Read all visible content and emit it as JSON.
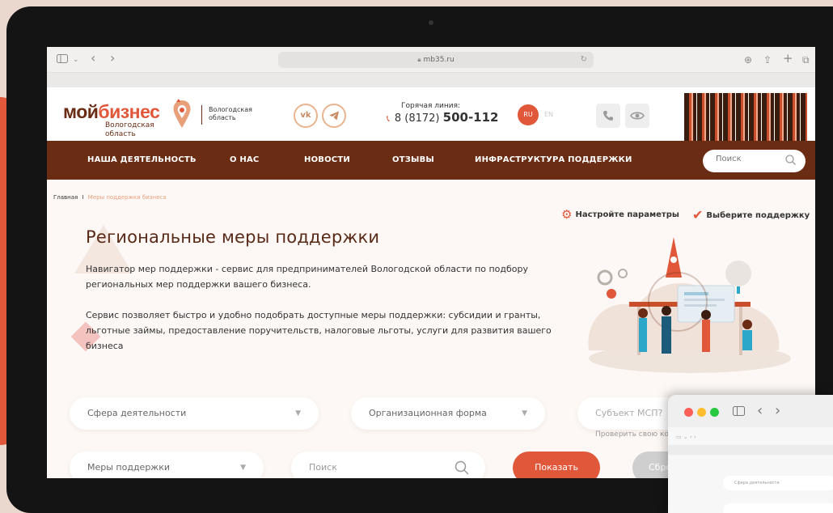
{
  "browser": {
    "url": "mb35.ru",
    "sidebar_icon": "sidebar-icon",
    "back_glyph": "‹",
    "forward_glyph": "›",
    "chevron_glyph": "⌄",
    "download_glyph": "⊕",
    "share_glyph": "⇪",
    "new_tab_glyph": "+",
    "tabs_glyph": "⧉",
    "reload_glyph": "↻"
  },
  "header": {
    "logo_part1": "мой",
    "logo_part2": "бизнес",
    "logo_sub": "Вологодская область",
    "region_line1": "Вологодская",
    "region_line2": "область",
    "vk_label": "vk",
    "hotline_label": "Горячая линия:",
    "hotline_prefix": "8 (8172)",
    "hotline_number": "500-112",
    "lang_ru": "RU",
    "lang_en": "EN"
  },
  "nav": {
    "items": [
      "НАША ДЕЯТЕЛЬНОСТЬ",
      "О НАС",
      "НОВОСТИ",
      "ОТЗЫВЫ",
      "ИНФРАСТРУКТУРА ПОДДЕРЖКИ"
    ],
    "search_placeholder": "Поиск"
  },
  "breadcrumb": {
    "home": "Главная",
    "separator": "I",
    "current": "Меры поддержки бизнеса"
  },
  "steps": {
    "params": "Настройте параметры",
    "choose": "Выберите поддержку"
  },
  "content": {
    "title": "Региональные меры поддержки",
    "para1_line1": "Навигатор мер поддержки - сервис для предпринимателей Вологодской области по подбору",
    "para1_line2": "региональных мер поддержки вашего бизнеса.",
    "para2_line1": "Сервис позволяет быстро и удобно подобрать доступные меры поддержки: субсидии и гранты,",
    "para2_line2": "льготные займы, предоставление поручительств, налоговые льготы, услуги для развития вашего",
    "para2_line3": "бизнеса"
  },
  "filters": {
    "activity": "Сфера деятельности",
    "org_form": "Организационная форма",
    "smp": "Субъект МСП?",
    "smp_check": "Проверить свою ком",
    "measures": "Меры поддержки",
    "search_placeholder": "Поиск",
    "show_button": "Показать",
    "reset_button": "Сброс"
  },
  "window2": {
    "mini_field": "Сфера деятельности"
  },
  "colors": {
    "brand_brown": "#6b2c14",
    "accent": "#e0573a",
    "background": "#fdf8f5"
  }
}
